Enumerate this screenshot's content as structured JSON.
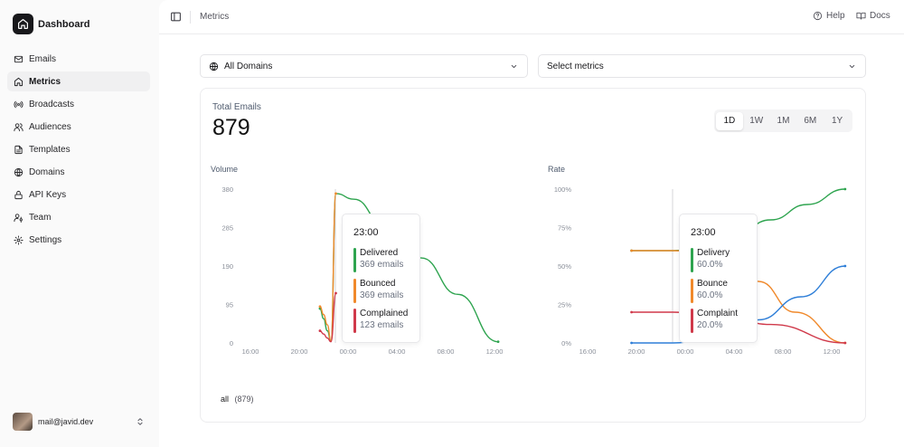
{
  "app": {
    "brand": "Dashboard"
  },
  "sidebar": {
    "items": [
      {
        "label": "Emails",
        "icon": "mail-icon",
        "active": false
      },
      {
        "label": "Metrics",
        "icon": "home-icon",
        "active": true
      },
      {
        "label": "Broadcasts",
        "icon": "broadcast-icon",
        "active": false
      },
      {
        "label": "Audiences",
        "icon": "users-icon",
        "active": false
      },
      {
        "label": "Templates",
        "icon": "file-icon",
        "active": false
      },
      {
        "label": "Domains",
        "icon": "globe-icon",
        "active": false
      },
      {
        "label": "API Keys",
        "icon": "lock-icon",
        "active": false
      },
      {
        "label": "Team",
        "icon": "user-key-icon",
        "active": false
      },
      {
        "label": "Settings",
        "icon": "gear-icon",
        "active": false
      }
    ],
    "user": {
      "email": "mail@javid.dev"
    }
  },
  "header": {
    "breadcrumb": "Metrics",
    "help": "Help",
    "docs": "Docs"
  },
  "filters": {
    "domain": "All Domains",
    "metrics_placeholder": "Select metrics"
  },
  "summary": {
    "label": "Total Emails",
    "value": "879"
  },
  "ranges": {
    "options": [
      "1D",
      "1W",
      "1M",
      "6M",
      "1Y"
    ],
    "selected": "1D"
  },
  "legend": {
    "label": "all",
    "count": "(879)"
  },
  "colors": {
    "delivered": "#2ea44f",
    "bounced": "#f0892b",
    "complained": "#d0394a",
    "rate_blue": "#2f7fd8",
    "dark": "#18181b"
  },
  "chart_data": [
    {
      "type": "line",
      "title": "Volume",
      "x_ticks": [
        "16:00",
        "20:00",
        "00:00",
        "04:00",
        "08:00",
        "12:00"
      ],
      "y_ticks": [
        "380",
        "285",
        "190",
        "95",
        "0"
      ],
      "ylim": [
        0,
        380
      ],
      "series": [
        {
          "name": "Delivered",
          "points": [
            [
              21.7,
              85
            ],
            [
              22.0,
              60
            ],
            [
              22.3,
              30
            ],
            [
              22.6,
              5
            ],
            [
              23.0,
              369
            ],
            [
              24.5,
              355
            ],
            [
              27.0,
              290
            ],
            [
              30.0,
              210
            ],
            [
              33.0,
              120
            ],
            [
              36.3,
              3
            ]
          ]
        },
        {
          "name": "Bounced",
          "points": [
            [
              21.7,
              90
            ],
            [
              22.0,
              70
            ],
            [
              22.3,
              45
            ],
            [
              22.6,
              5
            ],
            [
              23.0,
              369
            ]
          ]
        },
        {
          "name": "Complained",
          "points": [
            [
              21.7,
              30
            ],
            [
              22.0,
              22
            ],
            [
              22.3,
              12
            ],
            [
              22.6,
              3
            ],
            [
              23.0,
              123
            ]
          ]
        }
      ],
      "tooltip": {
        "time": "23:00",
        "rows": [
          {
            "name": "Delivered",
            "value": "369 emails"
          },
          {
            "name": "Bounced",
            "value": "369 emails"
          },
          {
            "name": "Complained",
            "value": "123 emails"
          }
        ]
      }
    },
    {
      "type": "line",
      "title": "Rate",
      "x_ticks": [
        "16:00",
        "20:00",
        "00:00",
        "04:00",
        "08:00",
        "12:00"
      ],
      "y_ticks": [
        "100%",
        "75%",
        "50%",
        "25%",
        "0%"
      ],
      "ylim": [
        0,
        100
      ],
      "series": [
        {
          "name": "Delivery",
          "points": [
            [
              19.6,
              60
            ],
            [
              21.0,
              60
            ],
            [
              22.5,
              60
            ],
            [
              23.0,
              60
            ],
            [
              25.0,
              62
            ],
            [
              28.0,
              70
            ],
            [
              31.0,
              80
            ],
            [
              34.0,
              90
            ],
            [
              37.1,
              100
            ]
          ]
        },
        {
          "name": "Bounce",
          "points": [
            [
              19.6,
              60
            ],
            [
              21.0,
              60
            ],
            [
              22.5,
              60
            ],
            [
              23.0,
              60
            ],
            [
              27.0,
              58
            ],
            [
              30.0,
              40
            ],
            [
              33.0,
              20
            ],
            [
              37.1,
              0
            ]
          ]
        },
        {
          "name": "Complaint",
          "points": [
            [
              19.6,
              20
            ],
            [
              21.0,
              20
            ],
            [
              22.5,
              20
            ],
            [
              23.0,
              20
            ],
            [
              27.0,
              18
            ],
            [
              31.0,
              12
            ],
            [
              37.1,
              0
            ]
          ]
        },
        {
          "name": "",
          "points": [
            [
              19.6,
              0
            ],
            [
              21.0,
              0
            ],
            [
              22.5,
              0
            ],
            [
              23.0,
              0
            ],
            [
              26.0,
              2
            ],
            [
              30.0,
              15
            ],
            [
              33.5,
              30
            ],
            [
              37.1,
              50
            ]
          ]
        }
      ],
      "tooltip": {
        "time": "23:00",
        "rows": [
          {
            "name": "Delivery",
            "value": "60.0%"
          },
          {
            "name": "Bounce",
            "value": "60.0%"
          },
          {
            "name": "Complaint",
            "value": "20.0%"
          }
        ]
      }
    }
  ]
}
